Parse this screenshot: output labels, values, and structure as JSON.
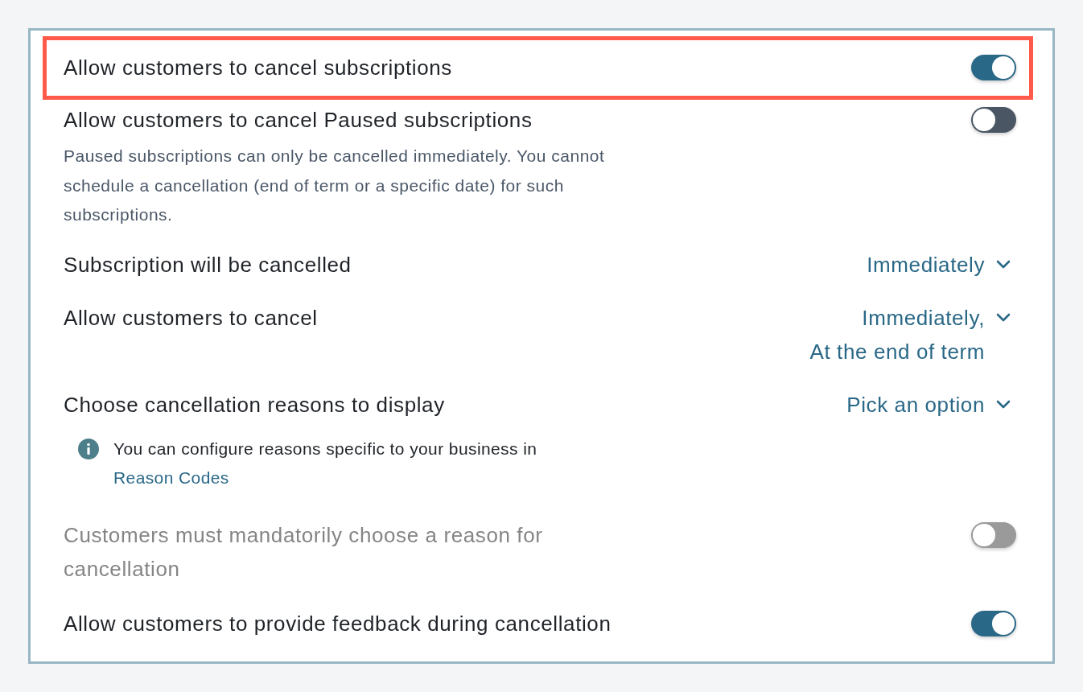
{
  "settings": [
    {
      "kind": "toggle",
      "label": "Allow customers to cancel subscriptions",
      "on": true,
      "disabled": false,
      "highlighted": true
    },
    {
      "kind": "toggle",
      "label": "Allow customers to cancel Paused subscriptions",
      "on": false,
      "disabled": false,
      "highlighted": false,
      "description": "Paused subscriptions can only be cancelled immediately. You cannot schedule a cancellation (end of term or a specific date) for such subscriptions."
    },
    {
      "kind": "dropdown",
      "label": "Subscription will be cancelled",
      "values": [
        "Immediately"
      ]
    },
    {
      "kind": "dropdown",
      "label": "Allow customers to cancel",
      "values": [
        "Immediately,",
        "At the end of term"
      ]
    },
    {
      "kind": "dropdown",
      "label": "Choose cancellation reasons to display",
      "values": [
        "Pick an option"
      ]
    },
    {
      "kind": "info",
      "text": "You can configure reasons specific to your business in",
      "link": "Reason Codes"
    },
    {
      "kind": "toggle",
      "label": "Customers must mandatorily choose a reason for cancellation",
      "on": false,
      "disabled": true,
      "highlighted": false
    },
    {
      "kind": "toggle",
      "label": "Allow customers to provide feedback during cancellation",
      "on": true,
      "disabled": false,
      "highlighted": false
    }
  ]
}
